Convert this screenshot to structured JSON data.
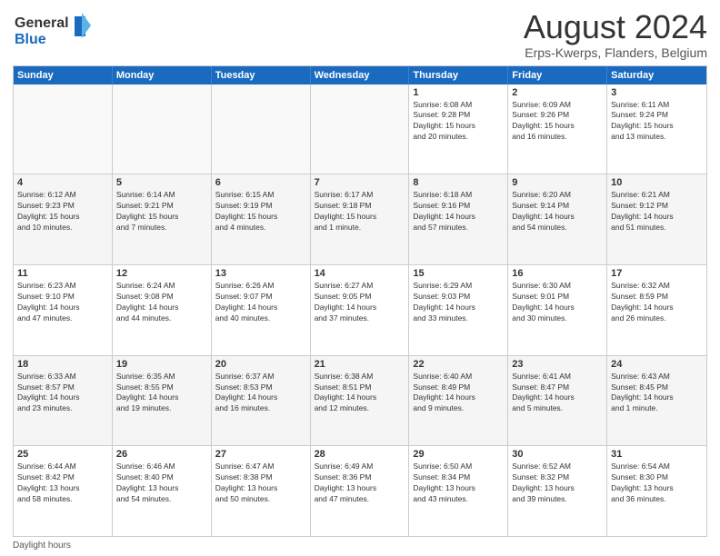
{
  "header": {
    "logo_line1": "General",
    "logo_line2": "Blue",
    "title": "August 2024",
    "subtitle": "Erps-Kwerps, Flanders, Belgium"
  },
  "days_of_week": [
    "Sunday",
    "Monday",
    "Tuesday",
    "Wednesday",
    "Thursday",
    "Friday",
    "Saturday"
  ],
  "footer": "Daylight hours",
  "weeks": [
    [
      {
        "day": "",
        "info": ""
      },
      {
        "day": "",
        "info": ""
      },
      {
        "day": "",
        "info": ""
      },
      {
        "day": "",
        "info": ""
      },
      {
        "day": "1",
        "info": "Sunrise: 6:08 AM\nSunset: 9:28 PM\nDaylight: 15 hours\nand 20 minutes."
      },
      {
        "day": "2",
        "info": "Sunrise: 6:09 AM\nSunset: 9:26 PM\nDaylight: 15 hours\nand 16 minutes."
      },
      {
        "day": "3",
        "info": "Sunrise: 6:11 AM\nSunset: 9:24 PM\nDaylight: 15 hours\nand 13 minutes."
      }
    ],
    [
      {
        "day": "4",
        "info": "Sunrise: 6:12 AM\nSunset: 9:23 PM\nDaylight: 15 hours\nand 10 minutes."
      },
      {
        "day": "5",
        "info": "Sunrise: 6:14 AM\nSunset: 9:21 PM\nDaylight: 15 hours\nand 7 minutes."
      },
      {
        "day": "6",
        "info": "Sunrise: 6:15 AM\nSunset: 9:19 PM\nDaylight: 15 hours\nand 4 minutes."
      },
      {
        "day": "7",
        "info": "Sunrise: 6:17 AM\nSunset: 9:18 PM\nDaylight: 15 hours\nand 1 minute."
      },
      {
        "day": "8",
        "info": "Sunrise: 6:18 AM\nSunset: 9:16 PM\nDaylight: 14 hours\nand 57 minutes."
      },
      {
        "day": "9",
        "info": "Sunrise: 6:20 AM\nSunset: 9:14 PM\nDaylight: 14 hours\nand 54 minutes."
      },
      {
        "day": "10",
        "info": "Sunrise: 6:21 AM\nSunset: 9:12 PM\nDaylight: 14 hours\nand 51 minutes."
      }
    ],
    [
      {
        "day": "11",
        "info": "Sunrise: 6:23 AM\nSunset: 9:10 PM\nDaylight: 14 hours\nand 47 minutes."
      },
      {
        "day": "12",
        "info": "Sunrise: 6:24 AM\nSunset: 9:08 PM\nDaylight: 14 hours\nand 44 minutes."
      },
      {
        "day": "13",
        "info": "Sunrise: 6:26 AM\nSunset: 9:07 PM\nDaylight: 14 hours\nand 40 minutes."
      },
      {
        "day": "14",
        "info": "Sunrise: 6:27 AM\nSunset: 9:05 PM\nDaylight: 14 hours\nand 37 minutes."
      },
      {
        "day": "15",
        "info": "Sunrise: 6:29 AM\nSunset: 9:03 PM\nDaylight: 14 hours\nand 33 minutes."
      },
      {
        "day": "16",
        "info": "Sunrise: 6:30 AM\nSunset: 9:01 PM\nDaylight: 14 hours\nand 30 minutes."
      },
      {
        "day": "17",
        "info": "Sunrise: 6:32 AM\nSunset: 8:59 PM\nDaylight: 14 hours\nand 26 minutes."
      }
    ],
    [
      {
        "day": "18",
        "info": "Sunrise: 6:33 AM\nSunset: 8:57 PM\nDaylight: 14 hours\nand 23 minutes."
      },
      {
        "day": "19",
        "info": "Sunrise: 6:35 AM\nSunset: 8:55 PM\nDaylight: 14 hours\nand 19 minutes."
      },
      {
        "day": "20",
        "info": "Sunrise: 6:37 AM\nSunset: 8:53 PM\nDaylight: 14 hours\nand 16 minutes."
      },
      {
        "day": "21",
        "info": "Sunrise: 6:38 AM\nSunset: 8:51 PM\nDaylight: 14 hours\nand 12 minutes."
      },
      {
        "day": "22",
        "info": "Sunrise: 6:40 AM\nSunset: 8:49 PM\nDaylight: 14 hours\nand 9 minutes."
      },
      {
        "day": "23",
        "info": "Sunrise: 6:41 AM\nSunset: 8:47 PM\nDaylight: 14 hours\nand 5 minutes."
      },
      {
        "day": "24",
        "info": "Sunrise: 6:43 AM\nSunset: 8:45 PM\nDaylight: 14 hours\nand 1 minute."
      }
    ],
    [
      {
        "day": "25",
        "info": "Sunrise: 6:44 AM\nSunset: 8:42 PM\nDaylight: 13 hours\nand 58 minutes."
      },
      {
        "day": "26",
        "info": "Sunrise: 6:46 AM\nSunset: 8:40 PM\nDaylight: 13 hours\nand 54 minutes."
      },
      {
        "day": "27",
        "info": "Sunrise: 6:47 AM\nSunset: 8:38 PM\nDaylight: 13 hours\nand 50 minutes."
      },
      {
        "day": "28",
        "info": "Sunrise: 6:49 AM\nSunset: 8:36 PM\nDaylight: 13 hours\nand 47 minutes."
      },
      {
        "day": "29",
        "info": "Sunrise: 6:50 AM\nSunset: 8:34 PM\nDaylight: 13 hours\nand 43 minutes."
      },
      {
        "day": "30",
        "info": "Sunrise: 6:52 AM\nSunset: 8:32 PM\nDaylight: 13 hours\nand 39 minutes."
      },
      {
        "day": "31",
        "info": "Sunrise: 6:54 AM\nSunset: 8:30 PM\nDaylight: 13 hours\nand 36 minutes."
      }
    ]
  ]
}
